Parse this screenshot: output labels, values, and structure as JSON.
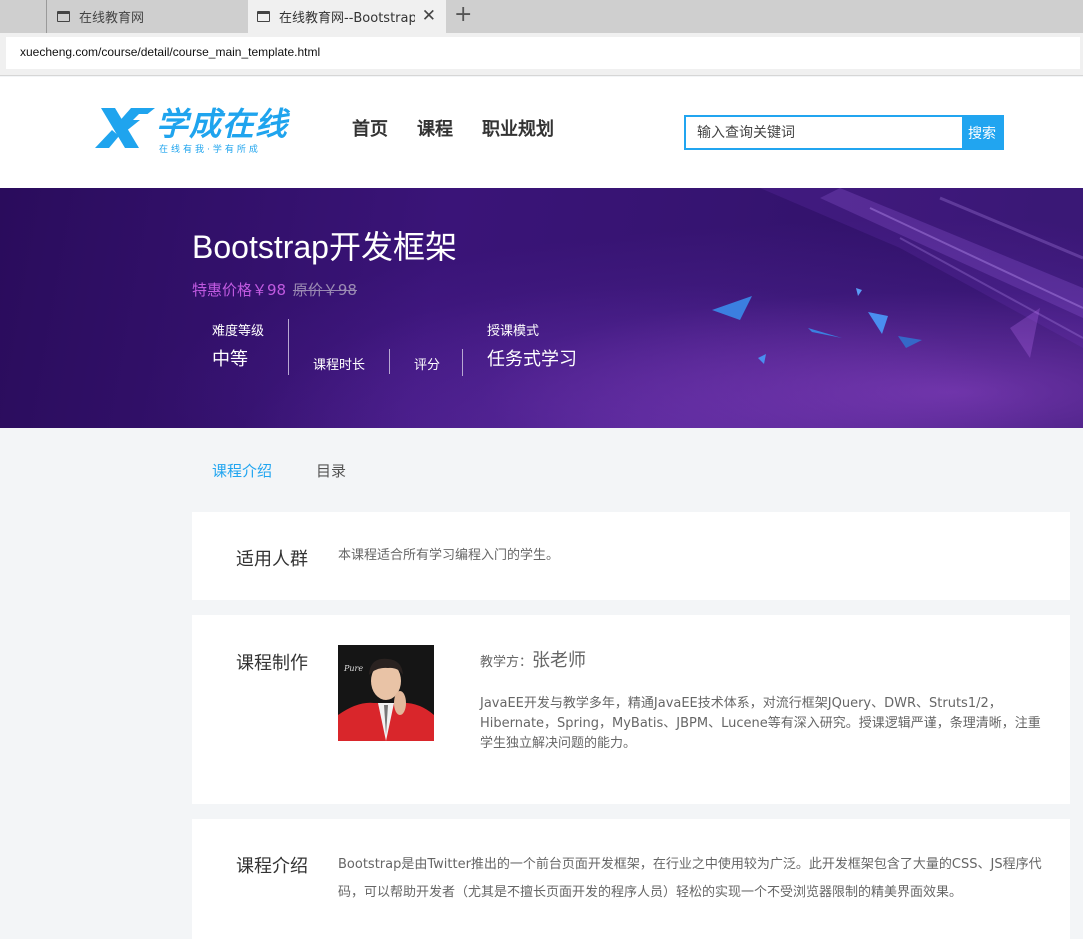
{
  "browser": {
    "tabs": [
      {
        "title": "在线教育网"
      },
      {
        "title": "在线教育网--Bootstrap开发框架"
      }
    ],
    "new_tab_glyph": "+",
    "close_glyph": "✕",
    "url": "xuecheng.com/course/detail/course_main_template.html"
  },
  "header": {
    "logo_text": "学成在线",
    "logo_slogan": "在线有我·学有所成",
    "nav": [
      "首页",
      "课程",
      "职业规划"
    ],
    "search_placeholder": "输入查询关键词",
    "search_button": "搜索",
    "brand_color": "#1fa4ee"
  },
  "course": {
    "title": "Bootstrap开发框架",
    "sale_price": "特惠价格￥98",
    "original_price": "原价￥98",
    "info": {
      "difficulty_label": "难度等级",
      "difficulty_value": "中等",
      "duration_label": "课程时长",
      "rating_label": "评分",
      "mode_label": "授课模式",
      "mode_value": "任务式学习"
    }
  },
  "tabs": [
    "课程介绍",
    "目录"
  ],
  "sections": {
    "audience": {
      "heading": "适用人群",
      "text": "本课程适合所有学习编程入门的学生。"
    },
    "producer": {
      "heading": "课程制作",
      "teacher_label": "教学方：",
      "teacher_name": "张老师",
      "bio": "JavaEE开发与教学多年，精通JavaEE技术体系，对流行框架JQuery、DWR、Struts1/2，Hibernate，Spring，MyBatis、JBPM、Lucene等有深入研究。授课逻辑严谨，条理清晰，注重学生独立解决问题的能力。",
      "photo_caption": "Pure"
    },
    "intro": {
      "heading": "课程介绍",
      "text": "Bootstrap是由Twitter推出的一个前台页面开发框架，在行业之中使用较为广泛。此开发框架包含了大量的CSS、JS程序代码，可以帮助开发者（尤其是不擅长页面开发的程序人员）轻松的实现一个不受浏览器限制的精美界面效果。"
    }
  }
}
